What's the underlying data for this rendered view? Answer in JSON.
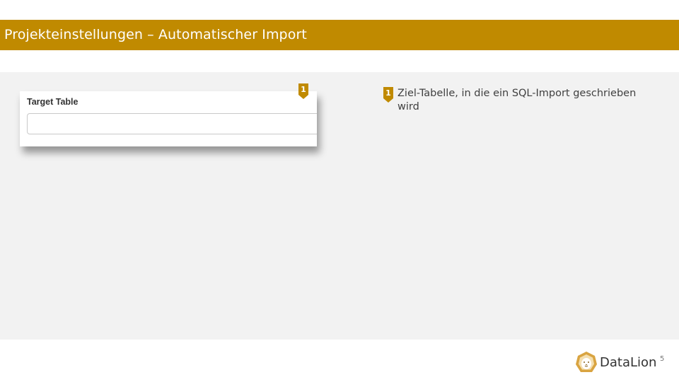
{
  "header": {
    "title": "Projekteinstellungen – Automatischer Import",
    "bar_color": "#c08a00"
  },
  "form": {
    "target_table_label": "Target Table",
    "target_table_value": "",
    "target_table_placeholder": ""
  },
  "callouts": [
    {
      "number": "1",
      "text": "Ziel-Tabelle, in die ein SQL-Import geschrieben wird"
    }
  ],
  "footer": {
    "logo_text": "DataLion",
    "logo_icon": "lion-head-icon",
    "page_number": "5"
  },
  "colors": {
    "accent": "#c08a00",
    "content_background": "#f2f2f2",
    "logo_ring": "#d9a441"
  }
}
